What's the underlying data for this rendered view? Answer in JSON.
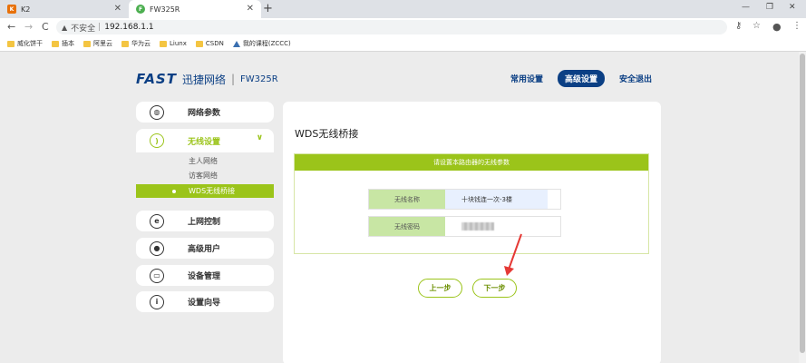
{
  "browser": {
    "tabs": [
      {
        "title": "K2",
        "favicon_color": "#e8710a",
        "favicon_glyph": "K",
        "active": false
      },
      {
        "title": "FW325R",
        "favicon_color": "#4caf50",
        "favicon_glyph": "F",
        "active": true
      }
    ],
    "new_tab_label": "+",
    "window_controls": [
      "—",
      "❐",
      "✕"
    ],
    "nav": {
      "back": "←",
      "forward": "→",
      "reload": "C"
    },
    "address": {
      "warning_icon": "▲",
      "security_text": "不安全",
      "separator": "|",
      "url": "192.168.1.1"
    },
    "toolbar_icons": [
      "key-icon",
      "star-icon",
      "account-icon",
      "menu-icon"
    ],
    "bookmarks": [
      {
        "label": "威化饼干",
        "icon": "folder-icon"
      },
      {
        "label": "插本",
        "icon": "folder-icon"
      },
      {
        "label": "阿里云",
        "icon": "folder-icon"
      },
      {
        "label": "华为云",
        "icon": "folder-icon"
      },
      {
        "label": "Liunx",
        "icon": "folder-icon"
      },
      {
        "label": "CSDN",
        "icon": "folder-icon"
      },
      {
        "label": "我的课程(ZCCC)",
        "icon": "triangle-icon"
      }
    ]
  },
  "header": {
    "brand": "FAST",
    "brand_cn": "迅捷网络",
    "separator": "|",
    "model": "FW325R",
    "nav": [
      {
        "label": "常用设置",
        "active": false
      },
      {
        "label": "高级设置",
        "active": true
      },
      {
        "label": "安全退出",
        "active": false
      }
    ]
  },
  "sidebar": {
    "items": [
      {
        "label": "网络参数",
        "icon": "globe-icon"
      },
      {
        "label": "无线设置",
        "icon": "wifi-icon",
        "open": true
      },
      {
        "label": "上网控制",
        "icon": "control-icon"
      },
      {
        "label": "高级用户",
        "icon": "user-icon"
      },
      {
        "label": "设备管理",
        "icon": "device-icon"
      },
      {
        "label": "设置向导",
        "icon": "info-icon"
      }
    ],
    "submenu": [
      {
        "label": "主人网络",
        "active": false
      },
      {
        "label": "访客网络",
        "active": false
      },
      {
        "label": "WDS无线桥接",
        "active": true
      }
    ]
  },
  "panel": {
    "title": "WDS无线桥接",
    "box_header": "请设置本路由器的无线参数",
    "fields": [
      {
        "label": "无线名称",
        "value": "十块钱连一次-3楼"
      },
      {
        "label": "无线密码",
        "value": ""
      }
    ],
    "buttons": {
      "prev": "上一步",
      "next": "下一步"
    }
  },
  "annotation": {
    "arrow_color": "#e53935"
  },
  "colors": {
    "brand": "#0b3f84",
    "accent": "#9bc41a"
  }
}
